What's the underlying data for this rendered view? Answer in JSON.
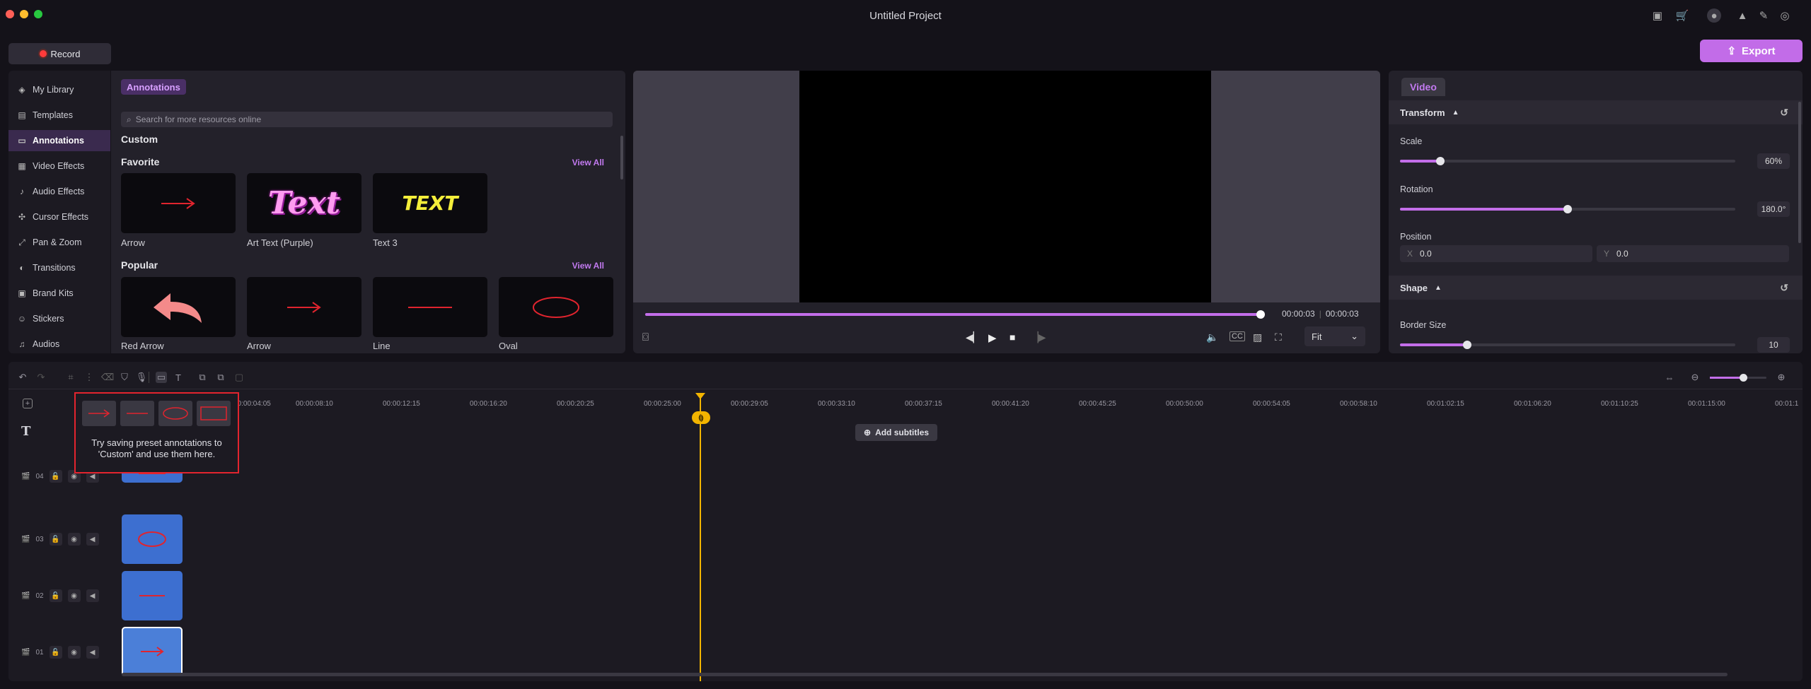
{
  "window": {
    "title": "Untitled Project"
  },
  "toolbar": {
    "record_label": "Record",
    "export_label": "Export"
  },
  "sidebar": {
    "items": [
      {
        "label": "My Library",
        "icon": "layers-icon"
      },
      {
        "label": "Templates",
        "icon": "templates-icon"
      },
      {
        "label": "Annotations",
        "icon": "annotation-icon"
      },
      {
        "label": "Video Effects",
        "icon": "video-effects-icon"
      },
      {
        "label": "Audio Effects",
        "icon": "audio-effects-icon"
      },
      {
        "label": "Cursor Effects",
        "icon": "cursor-icon"
      },
      {
        "label": "Pan & Zoom",
        "icon": "pan-zoom-icon"
      },
      {
        "label": "Transitions",
        "icon": "transitions-icon"
      },
      {
        "label": "Brand Kits",
        "icon": "brand-kit-icon"
      },
      {
        "label": "Stickers",
        "icon": "sticker-icon"
      },
      {
        "label": "Audios",
        "icon": "music-icon"
      }
    ],
    "active": "Annotations"
  },
  "library": {
    "tab": "Annotations",
    "search_placeholder": "Search for more resources online",
    "custom_title": "Custom",
    "favorite_title": "Favorite",
    "popular_title": "Popular",
    "view_all": "View All",
    "favorite": [
      {
        "label": "Arrow"
      },
      {
        "label": "Art Text (Purple)",
        "art": "Text"
      },
      {
        "label": "Text 3",
        "art": "TEXT"
      }
    ],
    "popular": [
      {
        "label": "Red Arrow"
      },
      {
        "label": "Arrow"
      },
      {
        "label": "Line"
      },
      {
        "label": "Oval"
      }
    ]
  },
  "preview": {
    "current_time": "00:00:03",
    "total_time": "00:00:03",
    "progress": 1.0,
    "zoom_value": "Fit"
  },
  "inspector": {
    "tab": "Video",
    "transform_title": "Transform",
    "scale_label": "Scale",
    "scale_value": "60%",
    "scale_level": 0.12,
    "rotation_label": "Rotation",
    "rotation_value": "180.0°",
    "rotation_level": 0.5,
    "position_label": "Position",
    "pos_x_axis": "X",
    "pos_x": "0.0",
    "pos_y_axis": "Y",
    "pos_y": "0.0",
    "shape_title": "Shape",
    "border_label": "Border Size",
    "border_value": "10",
    "border_level": 0.2
  },
  "timeline": {
    "ticks": [
      "00:00:04:05",
      "00:00:08:10",
      "00:00:12:15",
      "00:00:16:20",
      "00:00:20:25",
      "00:00:25:00",
      "00:00:29:05",
      "00:00:33:10",
      "00:00:37:15",
      "00:00:41:20",
      "00:00:45:25",
      "00:00:50:00",
      "00:00:54:05",
      "00:00:58:10",
      "00:01:02:15",
      "00:01:06:20",
      "00:01:10:25",
      "00:01:15:00",
      "00:01:1"
    ],
    "add_subtitles": "Add subtitles",
    "tracks": [
      "04",
      "03",
      "02",
      "01"
    ],
    "tooltip": "Try saving preset annotations to 'Custom' and use them here."
  },
  "colors": {
    "accent": "#c26ce8",
    "playhead": "#f2b400",
    "clip": "#3d6fd0",
    "annotation_red": "#e0242e"
  }
}
